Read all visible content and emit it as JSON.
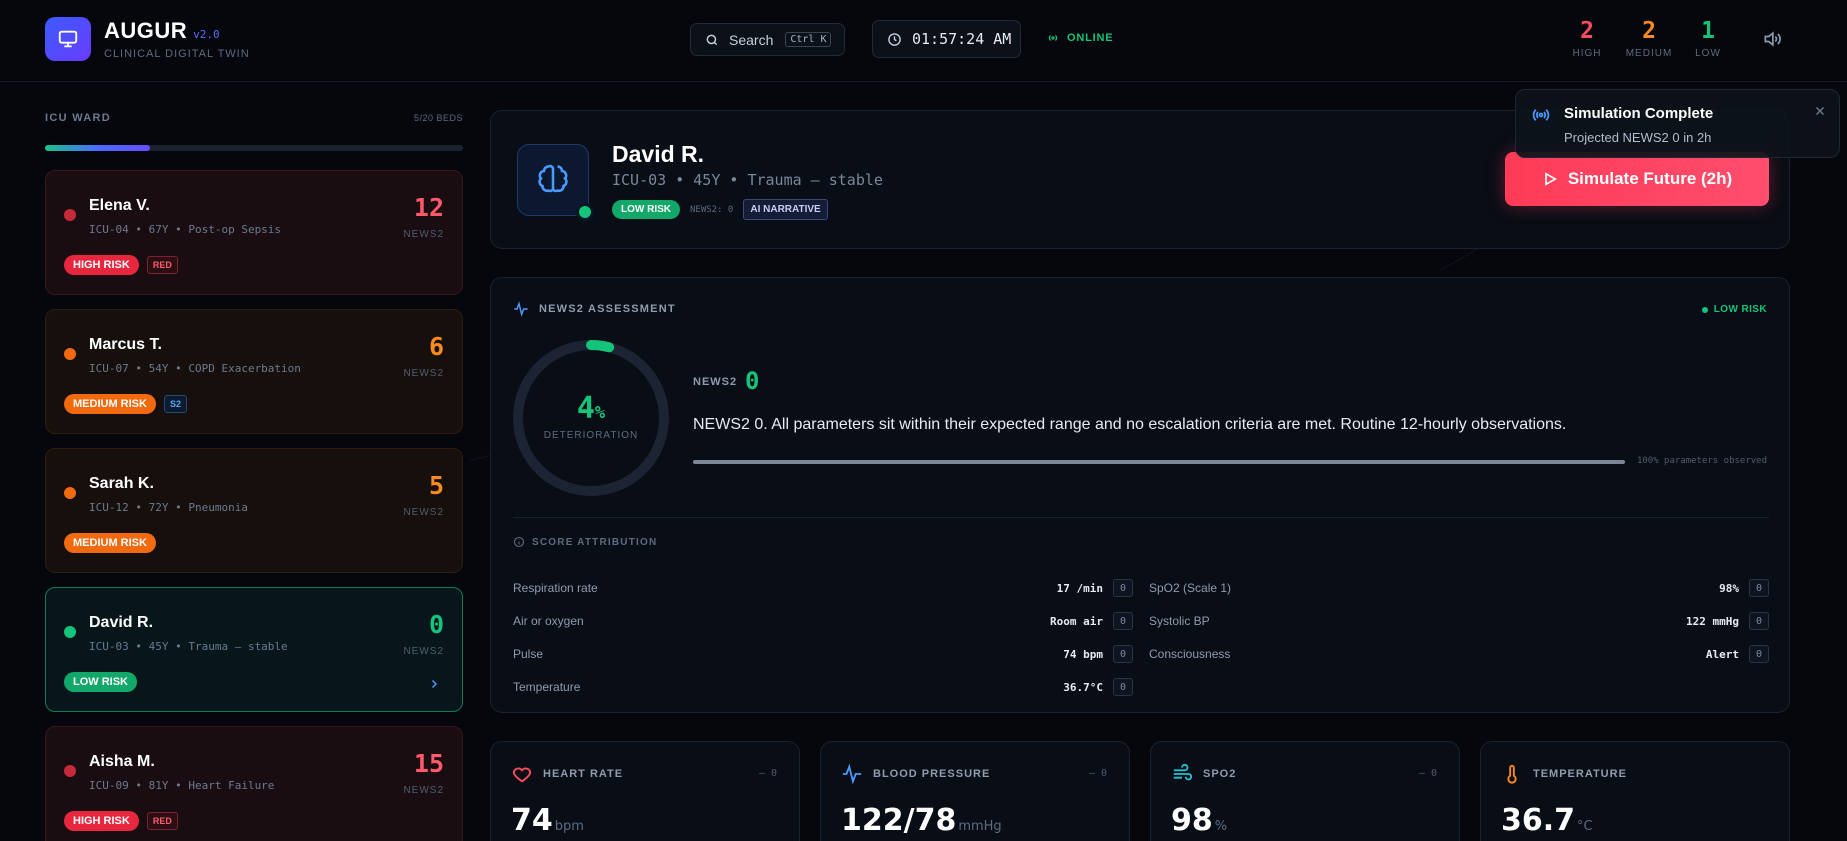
{
  "header": {
    "brand": "AUGUR",
    "version": "v2.0",
    "subtitle": "CLINICAL DIGITAL TWIN",
    "search_label": "Search",
    "search_shortcut": "Ctrl K",
    "clock": "01:57:24 AM",
    "status": "ONLINE",
    "counters": [
      {
        "value": "2",
        "label": "HIGH",
        "color": "#ff4d5e"
      },
      {
        "value": "2",
        "label": "MEDIUM",
        "color": "#ff8a1f"
      },
      {
        "value": "1",
        "label": "LOW",
        "color": "#13c47a"
      }
    ]
  },
  "sidebar": {
    "title": "ICU WARD",
    "beds": "5/20 BEDS",
    "occupancy_fraction": 0.25,
    "patients": [
      {
        "name": "Elena V.",
        "meta": "ICU-04 • 67Y • Post-op Sepsis",
        "score": "12",
        "score_label": "NEWS2",
        "risk": "HIGH RISK",
        "tag": "RED",
        "color": "#e8273f"
      },
      {
        "name": "Marcus T.",
        "meta": "ICU-07 • 54Y • COPD Exacerbation",
        "score": "6",
        "score_label": "NEWS2",
        "risk": "MEDIUM RISK",
        "tag": "S2",
        "color": "#f26a10"
      },
      {
        "name": "Sarah K.",
        "meta": "ICU-12 • 72Y • Pneumonia",
        "score": "5",
        "score_label": "NEWS2",
        "risk": "MEDIUM RISK",
        "tag": "",
        "color": "#f26a10"
      },
      {
        "name": "David R.",
        "meta": "ICU-03 • 45Y • Trauma — stable",
        "score": "0",
        "score_label": "NEWS2",
        "risk": "LOW RISK",
        "tag": "",
        "color": "#13c47a"
      },
      {
        "name": "Aisha M.",
        "meta": "ICU-09 • 81Y • Heart Failure",
        "score": "15",
        "score_label": "NEWS2",
        "risk": "HIGH RISK",
        "tag": "RED",
        "color": "#e8273f"
      }
    ]
  },
  "patient": {
    "name": "David R.",
    "meta": "ICU-03 • 45Y • Trauma — stable",
    "risk": "LOW RISK",
    "news_small": "NEWS2: 0",
    "ai_tag": "AI NARRATIVE",
    "simulate_label": "Simulate Future (2h)"
  },
  "toast": {
    "title": "Simulation Complete",
    "subtitle": "Projected NEWS2 0 in 2h"
  },
  "assessment": {
    "title": "NEWS2 ASSESSMENT",
    "risk": "LOW RISK",
    "deterioration_value": "4",
    "deterioration_unit": "%",
    "deterioration_fraction": 0.04,
    "deterioration_label": "DETERIORATION",
    "news_label": "NEWS2",
    "news_value": "0",
    "narrative": "NEWS2 0. All parameters sit within their expected range and no escalation criteria are met. Routine 12-hourly observations.",
    "observed_fraction": 1.0,
    "observed_label": "100% parameters observed",
    "attribution_title": "SCORE ATTRIBUTION",
    "left_rows": [
      {
        "label": "Respiration rate",
        "value": "17 /min",
        "score": "0"
      },
      {
        "label": "Air or oxygen",
        "value": "Room air",
        "score": "0"
      },
      {
        "label": "Pulse",
        "value": "74 bpm",
        "score": "0"
      },
      {
        "label": "Temperature",
        "value": "36.7°C",
        "score": "0"
      }
    ],
    "right_rows": [
      {
        "label": "SpO2 (Scale 1)",
        "value": "98%",
        "score": "0"
      },
      {
        "label": "Systolic BP",
        "value": "122 mmHg",
        "score": "0"
      },
      {
        "label": "Consciousness",
        "value": "Alert",
        "score": "0"
      }
    ]
  },
  "vitals": [
    {
      "title": "HEART RATE",
      "value": "74",
      "unit": "bpm",
      "trend": "– 0",
      "icon": "heart-icon",
      "color": "#ff4d5e"
    },
    {
      "title": "BLOOD PRESSURE",
      "value": "122/78",
      "unit": "mmHg",
      "trend": "– 0",
      "icon": "pulse-icon",
      "color": "#4a9bff"
    },
    {
      "title": "SPO2",
      "value": "98",
      "unit": "%",
      "trend": "– 0",
      "icon": "wind-icon",
      "color": "#22c4d4"
    },
    {
      "title": "TEMPERATURE",
      "value": "36.7",
      "unit": "°C",
      "trend": "",
      "icon": "thermometer-icon",
      "color": "#ff8a1f"
    }
  ]
}
